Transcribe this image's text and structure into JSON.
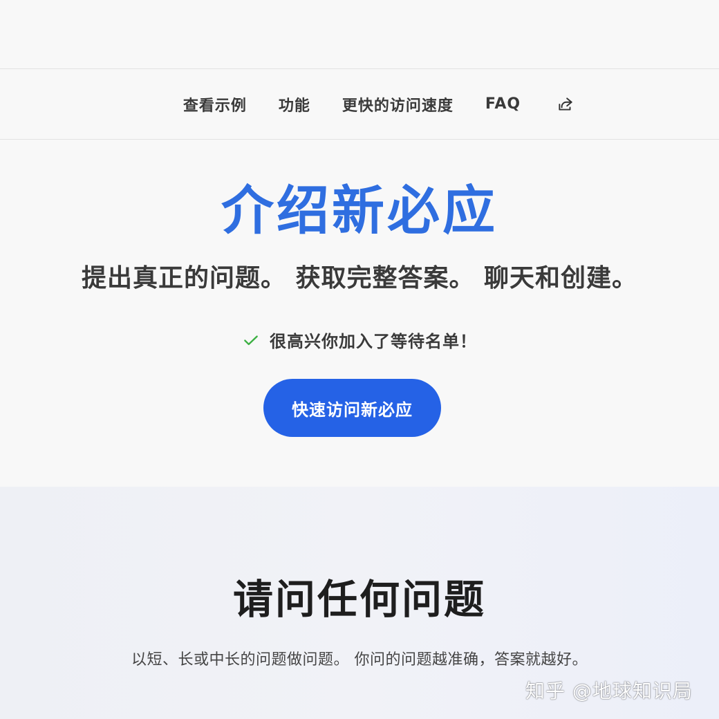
{
  "nav": {
    "items": [
      {
        "label": "查看示例"
      },
      {
        "label": "功能"
      },
      {
        "label": "更快的访问速度"
      },
      {
        "label": "FAQ"
      }
    ],
    "share_icon": "share-icon"
  },
  "hero": {
    "title": "介绍新必应",
    "subtitle": "提出真正的问题。 获取完整答案。 聊天和创建。",
    "waitlist_message": "很高兴你加入了等待名单！",
    "cta_label": "快速访问新必应"
  },
  "section": {
    "title": "请问任何问题",
    "description": "以短、长或中长的问题做问题。 你问的问题越准确，答案就越好。"
  },
  "watermark": "知乎 @地球知识局",
  "colors": {
    "accent": "#2562e6",
    "title_blue": "#2f6ee0",
    "check_green": "#3cb043"
  }
}
